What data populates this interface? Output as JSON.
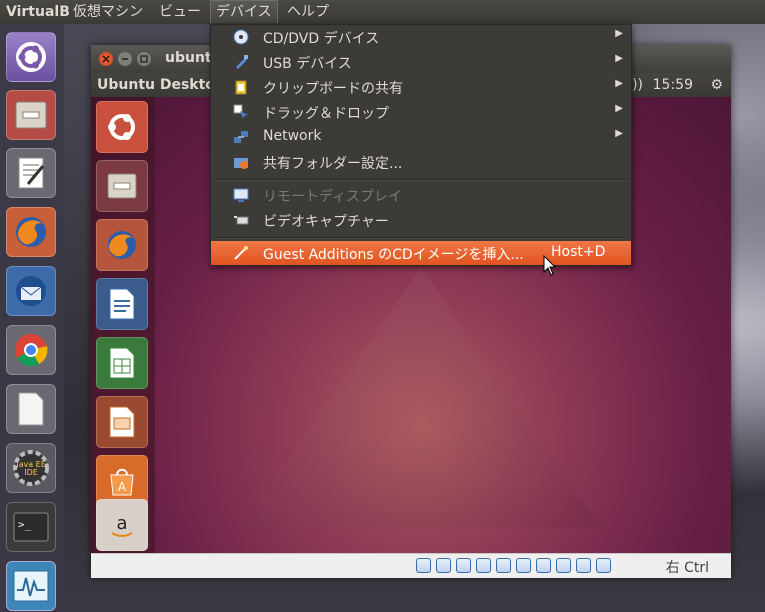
{
  "host_menubar": {
    "app_title": "VirtualB",
    "menus": [
      "仮想マシン",
      "ビュー",
      "デバイス",
      "ヘルプ"
    ],
    "active_menu": "デバイス"
  },
  "vm_window": {
    "title": "ubuntu",
    "guest_menubar_title": "Ubuntu Desktop",
    "clock": "15:59"
  },
  "devices_menu": {
    "items": [
      {
        "label": "CD/DVD デバイス",
        "icon": "cd-icon",
        "submenu": true
      },
      {
        "label": "USB デバイス",
        "icon": "usb-icon",
        "submenu": true
      },
      {
        "label": "クリップボードの共有",
        "icon": "clipboard-icon",
        "submenu": true
      },
      {
        "label": "ドラッグ＆ドロップ",
        "icon": "drag-drop-icon",
        "submenu": true
      },
      {
        "label": "Network",
        "icon": "network-icon",
        "submenu": true
      },
      {
        "label": "共有フォルダー設定...",
        "icon": "shared-folder-icon",
        "submenu": false
      },
      {
        "label": "リモートディスプレイ",
        "icon": "remote-display-icon",
        "disabled": true
      },
      {
        "label": "ビデオキャプチャー",
        "icon": "video-capture-icon",
        "disabled": false
      },
      {
        "label": "Guest Additions のCDイメージを挿入...",
        "icon": "install-icon",
        "highlighted": true,
        "shortcut": "Host+D"
      }
    ],
    "submenu_arrow": "▶"
  },
  "statusbar": {
    "host_key": "右 Ctrl"
  },
  "colors": {
    "menu_bg": "#3c3b37",
    "highlight": "#e86a34",
    "menu_text": "#dfdbd2"
  }
}
